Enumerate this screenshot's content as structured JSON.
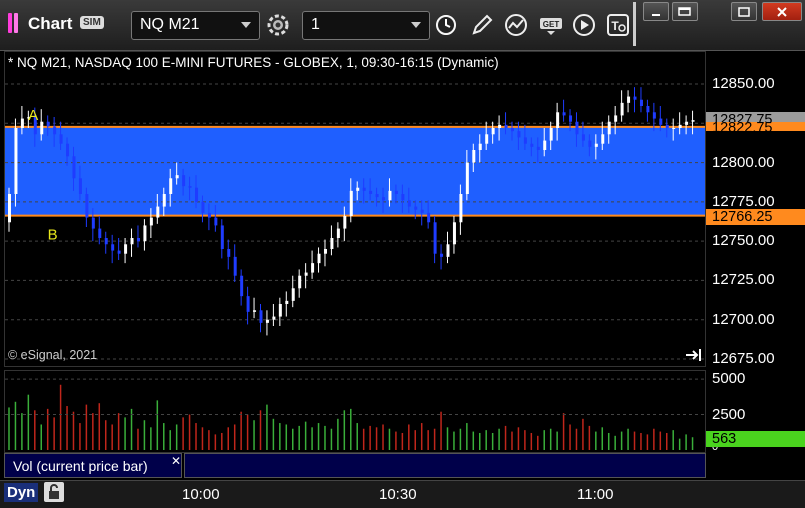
{
  "window": {
    "title": "Chart",
    "sim_badge": "SIM"
  },
  "toolbar": {
    "symbol": "NQ M21",
    "interval": "1"
  },
  "chart_data": {
    "type": "line",
    "title": "* NQ M21, NASDAQ 100 E-MINI FUTURES - GLOBEX, 1, 09:30-16:15 (Dynamic)",
    "copyright": "© eSignal, 2021",
    "x_ticks": [
      "10:00",
      "10:30",
      "11:00"
    ],
    "y_ticks": [
      "12850.00",
      "12825.00",
      "12800.00",
      "12775.00",
      "12750.00",
      "12725.00",
      "12700.00",
      "12675.00"
    ],
    "ylim": [
      12675,
      12860
    ],
    "zone": {
      "top": 12822.75,
      "bottom": 12766.25,
      "top_label": "12822.75",
      "bottom_label": "12766.25",
      "color": "#1f5fff"
    },
    "last_price": {
      "value": 12827.75,
      "label": "12827.75"
    },
    "annotations": [
      {
        "text": "A",
        "price": 12827,
        "bar": 5
      },
      {
        "text": "B",
        "price": 12751,
        "bar": 8
      }
    ],
    "series": [
      {
        "values": [
          12780,
          12822,
          12828,
          12829,
          12818,
          12826,
          12823,
          12818,
          12812,
          12804,
          12790,
          12780,
          12765,
          12758,
          12752,
          12748,
          12744,
          12742,
          12748,
          12752,
          12750,
          12760,
          12765,
          12772,
          12780,
          12790,
          12792,
          12785,
          12784,
          12775,
          12768,
          12765,
          12760,
          12745,
          12740,
          12728,
          12715,
          12705,
          12706,
          12698,
          12700,
          12702,
          12710,
          12712,
          12720,
          12728,
          12730,
          12736,
          12742,
          12745,
          12752,
          12758,
          12766,
          12782,
          12784,
          12782,
          12780,
          12778,
          12776,
          12782,
          12780,
          12776,
          12772,
          12770,
          12768,
          12762,
          12742,
          12740,
          12748,
          12762,
          12780,
          12800,
          12808,
          12812,
          12818,
          12822,
          12824,
          12822,
          12820,
          12816,
          12812,
          12810,
          12808,
          12814,
          12822,
          12832,
          12830,
          12826,
          12818,
          12814,
          12810,
          12812,
          12818,
          12826,
          12830,
          12838,
          12842,
          12840,
          12836,
          12832,
          12828,
          12824,
          12822,
          12822,
          12824,
          12826,
          12827
        ]
      }
    ],
    "volume": {
      "label": "Vol (current price bar)",
      "last_label": "563",
      "ticks": [
        "5000",
        "2500",
        "0"
      ],
      "ymax": 5500,
      "values": [
        3000,
        3400,
        2600,
        3900,
        2800,
        1800,
        2900,
        2300,
        4600,
        3100,
        2700,
        1900,
        3200,
        2600,
        3300,
        2100,
        1800,
        2600,
        2300,
        2900,
        1500,
        2100,
        1600,
        3500,
        1900,
        1400,
        1800,
        2300,
        2500,
        1900,
        1600,
        1400,
        1100,
        1200,
        1600,
        1800,
        2700,
        2500,
        2100,
        2800,
        3200,
        2200,
        1900,
        1800,
        1500,
        1700,
        2000,
        1600,
        1900,
        1700,
        1500,
        2200,
        2800,
        2900,
        1900,
        1500,
        1700,
        1600,
        1800,
        1500,
        1300,
        1200,
        1800,
        1400,
        1900,
        1400,
        1500,
        2700,
        1600,
        1300,
        1500,
        1900,
        1300,
        1200,
        1400,
        1200,
        1500,
        1700,
        1300,
        1600,
        1400,
        1200,
        1000,
        1400,
        1500,
        1300,
        2600,
        1800,
        1500,
        2200,
        1700,
        1300,
        1600,
        1200,
        1000,
        1300,
        1500,
        1300,
        1200,
        1100,
        1500,
        1300,
        1200,
        1400,
        800,
        1100,
        900
      ]
    },
    "colors": {
      "up_candle": "#ffffff",
      "down_candle": "#1f3cff",
      "zone_line": "#ff8a1e",
      "volume_up": "#3aaf3a",
      "volume_down": "#c0261b",
      "last_tag": "#4ad31e",
      "annotation": "#e8e81c"
    }
  },
  "status_bar": {
    "mode": "Dyn"
  }
}
